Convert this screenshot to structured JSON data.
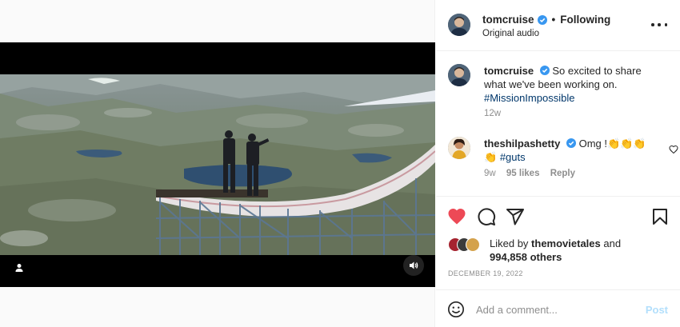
{
  "post": {
    "username": "tomcruise",
    "separator": "•",
    "follow_status": "Following",
    "audio": "Original audio"
  },
  "caption": {
    "username": "tomcruise",
    "text": "So excited to share what we've been working on.",
    "hashtag": "#MissionImpossible",
    "age": "12w"
  },
  "comments": [
    {
      "username": "theshilpashetty",
      "text": "Omg !👏👏👏",
      "text2": "👏",
      "hashtag": "#guts",
      "age": "9w",
      "likes": "95 likes",
      "reply": "Reply"
    }
  ],
  "likes": {
    "prefix": "Liked by",
    "user": "themovietales",
    "and": "and",
    "count": "994,858 others"
  },
  "date": "DECEMBER 19, 2022",
  "comment_box": {
    "placeholder": "Add a comment...",
    "post_label": "Post"
  },
  "colors": {
    "like_red": "#ed4956",
    "verified_blue": "#3897f0",
    "link": "#00376b",
    "post_disabled": "#b2dffc"
  },
  "icons": {
    "user_tag": "person-icon",
    "mute": "speaker-icon",
    "more": "more-horizontal-icon",
    "like": "heart-filled-icon",
    "comment": "comment-bubble-icon",
    "share": "paper-plane-icon",
    "save": "bookmark-icon",
    "emoji": "smiley-icon"
  }
}
